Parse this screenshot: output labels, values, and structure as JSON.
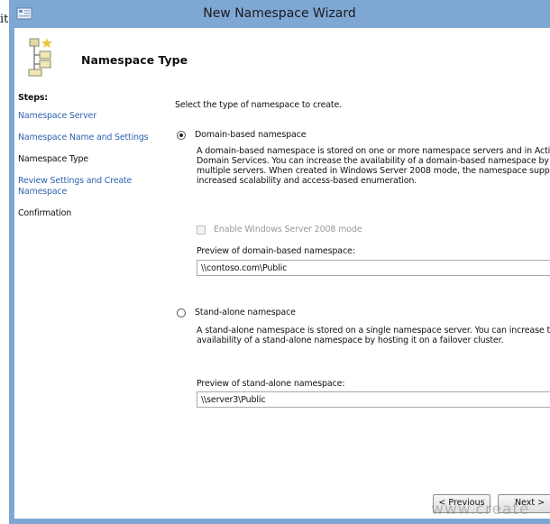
{
  "stray_text": "it",
  "window": {
    "title": "New Namespace Wizard"
  },
  "header": {
    "page_title": "Namespace Type"
  },
  "steps": {
    "heading": "Steps:",
    "items": [
      {
        "label": "Namespace Server",
        "state": "link"
      },
      {
        "label": "Namespace Name and Settings",
        "state": "link"
      },
      {
        "label": "Namespace Type",
        "state": "current"
      },
      {
        "label": "Review Settings and Create Namespace",
        "state": "link"
      },
      {
        "label": "Confirmation",
        "state": "plain"
      }
    ]
  },
  "main": {
    "prompt": "Select the type of namespace to create.",
    "domain": {
      "label": "Domain-based namespace",
      "selected": true,
      "description": [
        "A domain-based namespace is stored on one or more namespace servers and in Active",
        "Domain Services. You can increase the availability of a domain-based namespace by",
        "multiple servers. When created in Windows Server 2008 mode, the namespace suppo",
        "increased scalability and access-based enumeration."
      ],
      "checkbox_label": "Enable Windows Server 2008 mode",
      "checkbox_enabled": false,
      "preview_label": "Preview of domain-based namespace:",
      "preview_value": "\\\\contoso.com\\Public"
    },
    "standalone": {
      "label": "Stand-alone namespace",
      "selected": false,
      "description": [
        "A stand-alone namespace is stored on a single namespace server. You can increase t",
        "availability of a stand-alone namespace by hosting it on a failover cluster."
      ],
      "preview_label": "Preview of stand-alone namespace:",
      "preview_value": "\\\\server3\\Public"
    }
  },
  "buttons": {
    "previous": "< Previous",
    "next": "Next >"
  },
  "watermark": "www.create",
  "colors": {
    "titlebar": "#7fa7d4",
    "step_link": "#2f64b0"
  }
}
